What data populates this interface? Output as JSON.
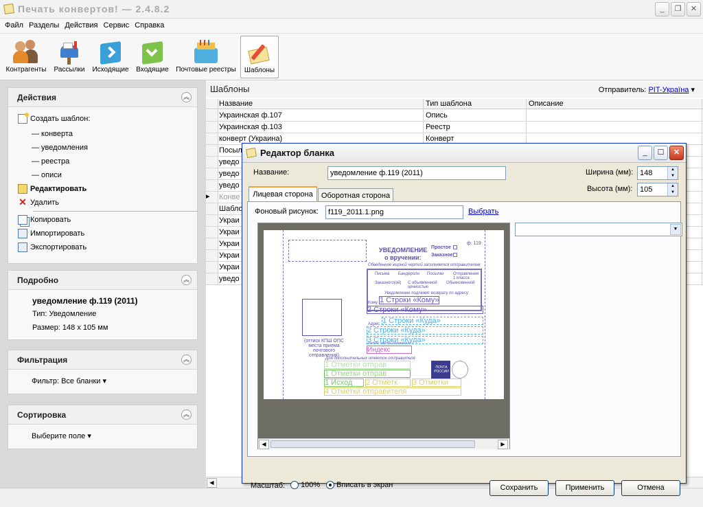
{
  "app": {
    "title": "Печать конвертов! — 2.4.8.2"
  },
  "menu": [
    "Файл",
    "Разделы",
    "Действия",
    "Сервис",
    "Справка"
  ],
  "toolbar": [
    {
      "label": "Контрагенты",
      "icon": "contacts-icon"
    },
    {
      "label": "Рассылки",
      "icon": "mailbox-icon"
    },
    {
      "label": "Исходящие",
      "icon": "outgoing-folder-icon"
    },
    {
      "label": "Входящие",
      "icon": "incoming-folder-icon"
    },
    {
      "label": "Почтовые реестры",
      "icon": "registry-icon"
    },
    {
      "label": "Шаблоны",
      "icon": "templates-icon",
      "active": true
    }
  ],
  "left": {
    "actions": {
      "title": "Действия",
      "create": "Создать шаблон:",
      "sub": [
        "— конверта",
        "— уведомления",
        "— реестра",
        "— описи"
      ],
      "edit": "Редактировать",
      "delete": "Удалить",
      "copy": "Копировать",
      "import": "Импортировать",
      "export": "Экспортировать"
    },
    "details": {
      "title": "Подробно",
      "name": "уведомление ф.119 (2011)",
      "type": "Тип: Уведомление",
      "size": "Размер: 148 х 105 мм"
    },
    "filter": {
      "title": "Фильтрация",
      "value": "Фильтр: Все бланки"
    },
    "sort": {
      "title": "Сортировка",
      "value": "Выберите поле"
    }
  },
  "right": {
    "title": "Шаблоны",
    "sender_label": "Отправитель:",
    "sender_value": "PIT-Україна",
    "columns": [
      "Название",
      "Тип шаблона",
      "Описание"
    ],
    "rows": [
      {
        "name": "Украинская ф.107",
        "type": "Опись"
      },
      {
        "name": "Украинская ф.103",
        "type": "Реестр"
      },
      {
        "name": "конверт (Украина)",
        "type": "Конверт"
      },
      {
        "name": "Посыл",
        "type": ""
      },
      {
        "name": "уведо",
        "type": ""
      },
      {
        "name": "уведо",
        "type": ""
      },
      {
        "name": "уведо",
        "type": ""
      },
      {
        "name": "Конве",
        "type": ""
      },
      {
        "name": "Шабло",
        "type": ""
      },
      {
        "name": "Украи",
        "type": ""
      },
      {
        "name": "Украи",
        "type": ""
      },
      {
        "name": "Украи",
        "type": ""
      },
      {
        "name": "Украи",
        "type": ""
      },
      {
        "name": "Украи",
        "type": ""
      },
      {
        "name": "уведо",
        "type": ""
      }
    ]
  },
  "dialog": {
    "title": "Редактор бланка",
    "name_label": "Название:",
    "name_value": "уведомление ф.119 (2011)",
    "width_label": "Ширина (мм):",
    "width_value": "148",
    "height_label": "Высота (мм):",
    "height_value": "105",
    "tabs": [
      "Лицевая сторона",
      "Оборотная сторона"
    ],
    "bg_label": "Фоновый рисунок:",
    "bg_value": "f119_2011.1.png",
    "bg_pick": "Выбрать",
    "scale_label": "Масштаб:",
    "scale_100": "100%",
    "scale_fit": "Вписать в экран",
    "save": "Сохранить",
    "apply": "Применить",
    "cancel": "Отмена",
    "form": {
      "title": "УВЕДОМЛЕНИЕ",
      "subtitle": "о вручении:",
      "f119": "ф. 119",
      "simple": "Простое",
      "registered": "Заказное",
      "note": "Обведенное жирной чертой заполняется отправителем",
      "letters": "Письма",
      "parcels": "Бандероли",
      "packages": "Посылки",
      "class1": "Отправления 1 класса",
      "ordered": "Заказного(ой)",
      "declared": "С объявленной ценностью",
      "ordinary": "Обыкновенной",
      "return": "Уведомление подлежит возврату по адресу:",
      "to": "Кому",
      "addr": "Адрес",
      "index": "Индекс места назначения",
      "stamp": "(оттиск КПШ ОПС места приема почтового отправления)",
      "additional": "Для дополнительных отметок отправителя",
      "post": "ПОЧТА РОССИИ",
      "f_kому1": "1 Строки «Кому»",
      "f_komu2": "2 Строки «Кому»",
      "f_kuda1": "1 Строки «Куда»",
      "f_kuda2": "2 Строки «Куда»",
      "f_kuda3": "3 Строки «Куда»",
      "f_index": "Индекс",
      "f_mark1": "1 Отметки отправ",
      "f_mark1b": "1 Отметки отправ",
      "f_ishod": "1 Исход",
      "f_mark2": "2 Отметк",
      "f_mark3": "3 Отметки",
      "f_mark4": "4 Отметки отправителя"
    }
  }
}
